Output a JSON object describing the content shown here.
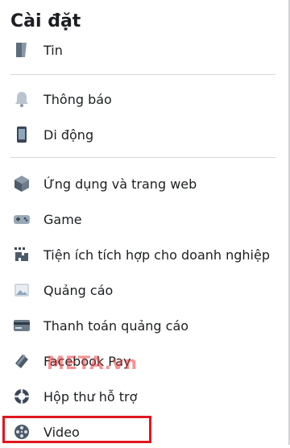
{
  "header": {
    "title": "Cài đặt"
  },
  "menu": [
    {
      "label": "Tin",
      "icon": "book-icon"
    },
    {
      "label": "Thông báo",
      "icon": "bell-icon"
    },
    {
      "label": "Di động",
      "icon": "phone-icon"
    },
    {
      "label": "Ứng dụng và trang web",
      "icon": "cube-icon"
    },
    {
      "label": "Game",
      "icon": "gamepad-icon"
    },
    {
      "label": "Tiện ích tích hợp cho doanh nghiệp",
      "icon": "puzzle-icon"
    },
    {
      "label": "Quảng cáo",
      "icon": "ad-image-icon"
    },
    {
      "label": "Thanh toán quảng cáo",
      "icon": "credit-card-icon"
    },
    {
      "label": "Facebook Pay",
      "icon": "pay-card-icon"
    },
    {
      "label": "Hộp thư hỗ trợ",
      "icon": "lifebuoy-icon"
    },
    {
      "label": "Video",
      "icon": "film-reel-icon"
    }
  ],
  "watermark": "META.vn",
  "colors": {
    "highlight": "#e0161f",
    "watermark": "#ef3b3b"
  }
}
